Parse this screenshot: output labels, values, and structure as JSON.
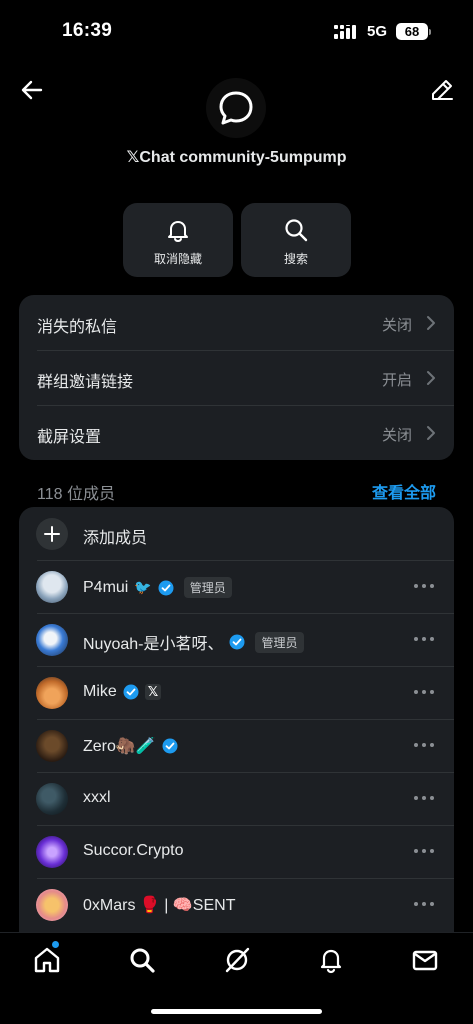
{
  "status_bar": {
    "time": "16:39",
    "network": "5G",
    "battery": "68"
  },
  "chat": {
    "title": "𝕏Chat community-5umpump"
  },
  "actions": [
    {
      "label": "取消隐藏",
      "icon": "bell-icon"
    },
    {
      "label": "搜索",
      "icon": "search-icon"
    }
  ],
  "settings": [
    {
      "name": "消失的私信",
      "value": "关闭"
    },
    {
      "name": "群组邀请链接",
      "value": "开启"
    },
    {
      "name": "截屏设置",
      "value": "关闭"
    }
  ],
  "members": {
    "count_label": "118 位成员",
    "view_all": "查看全部",
    "add_label": "添加成员",
    "admin_label": "管理员",
    "x_label": "𝕏",
    "list": [
      {
        "name": "P4mui",
        "extra": "🐦"
      },
      {
        "name": "Nuyoah-是小茗呀、",
        "extra": ""
      },
      {
        "name": "Mike",
        "extra": ""
      },
      {
        "name": "Zero🦣🧪",
        "extra": ""
      },
      {
        "name": "xxxl",
        "extra": ""
      },
      {
        "name": "Succor.Crypto",
        "extra": ""
      },
      {
        "name": "0xMars 🥊 | 🧠SENT",
        "extra": ""
      }
    ]
  },
  "nav": [
    "home-icon",
    "search-icon",
    "grok-icon",
    "notifications-icon",
    "messages-icon"
  ],
  "colors": {
    "accent": "#1d9bf0",
    "card": "#1c1f23",
    "muted": "#8b8f94"
  }
}
